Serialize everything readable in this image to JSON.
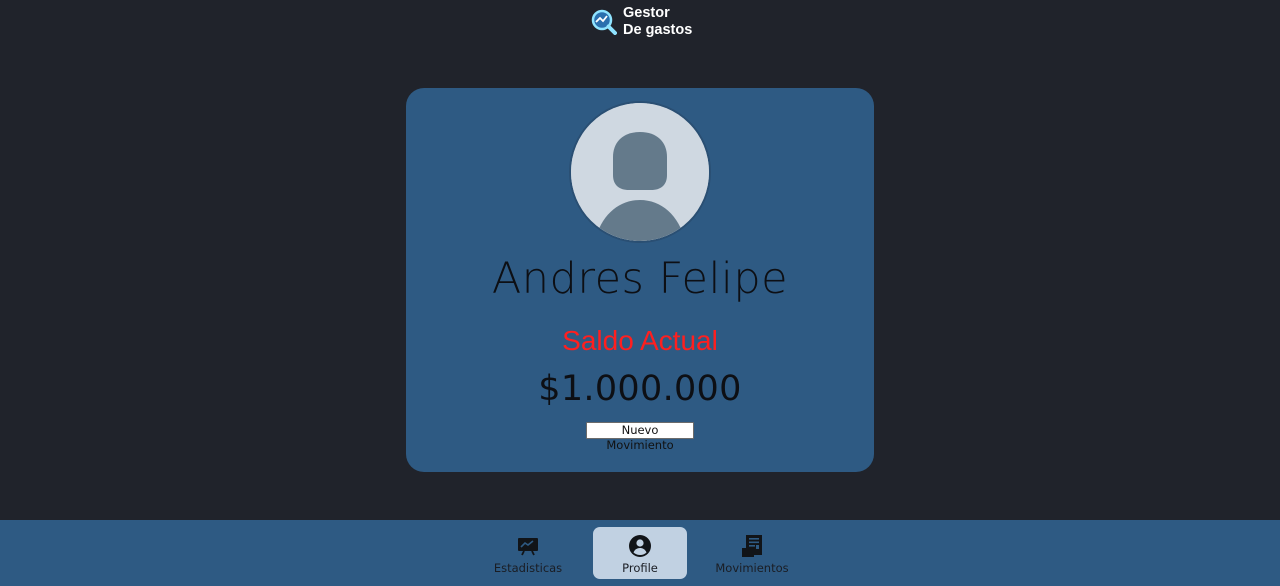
{
  "brand": {
    "line1": "Gestor",
    "line2": "De gastos",
    "icon": "magnifier-chart-icon"
  },
  "profile": {
    "name": "Andres Felipe",
    "balance_label": "Saldo Actual",
    "balance_value": "$1.000.000",
    "new_movement_label": "Nuevo Movimiento",
    "avatar_icon": "default-user-avatar"
  },
  "nav": {
    "items": [
      {
        "label": "Estadisticas",
        "icon": "chart-board-icon"
      },
      {
        "label": "Profile",
        "icon": "user-circle-icon",
        "active": true
      },
      {
        "label": "Movimientos",
        "icon": "receipt-icon"
      }
    ]
  },
  "colors": {
    "background": "#20232b",
    "card": "#2e5a83",
    "balance_label": "#ff1f1f",
    "nav_active": "#c1d1e2"
  }
}
